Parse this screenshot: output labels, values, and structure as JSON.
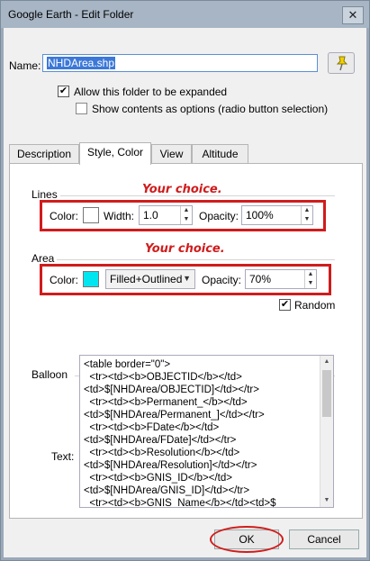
{
  "window": {
    "title": "Google Earth - Edit Folder",
    "close_glyph": "✕"
  },
  "name": {
    "label": "Name:",
    "value": "NHDArea.shp"
  },
  "options": {
    "allow_expand": {
      "label": "Allow this folder to be expanded",
      "checked": true
    },
    "show_contents": {
      "label": "Show contents as options (radio button selection)",
      "checked": false
    }
  },
  "tabs": [
    {
      "label": "Description",
      "active": false
    },
    {
      "label": "Style, Color",
      "active": true
    },
    {
      "label": "View",
      "active": false
    },
    {
      "label": "Altitude",
      "active": false
    }
  ],
  "lines": {
    "header": "Lines",
    "annotation": "Your choice.",
    "color_label": "Color:",
    "color": "#ffffff",
    "width_label": "Width:",
    "width_value": "1.0",
    "opacity_label": "Opacity:",
    "opacity_value": "100%"
  },
  "area": {
    "header": "Area",
    "annotation": "Your choice.",
    "color_label": "Color:",
    "color": "#00e6f0",
    "fill_value": "Filled+Outlined",
    "opacity_label": "Opacity:",
    "opacity_value": "70%",
    "random_label": "Random",
    "random_checked": true
  },
  "balloon": {
    "header": "Balloon",
    "text_label": "Text:",
    "text": "<table border=\"0\">\n  <tr><td><b>OBJECTID</b></td><td>$[NHDArea/OBJECTID]</td></tr>\n  <tr><td><b>Permanent_</b></td><td>$[NHDArea/Permanent_]</td></tr>\n  <tr><td><b>FDate</b></td><td>$[NHDArea/FDate]</td></tr>\n  <tr><td><b>Resolution</b></td><td>$[NHDArea/Resolution]</td></tr>\n  <tr><td><b>GNIS_ID</b></td><td>$[NHDArea/GNIS_ID]</td></tr>\n  <tr><td><b>GNIS_Name</b></td><td>$"
  },
  "buttons": {
    "ok": "OK",
    "cancel": "Cancel"
  },
  "colors": {
    "annotation_red": "#d01c1c",
    "selection_blue": "#3c78d8"
  }
}
